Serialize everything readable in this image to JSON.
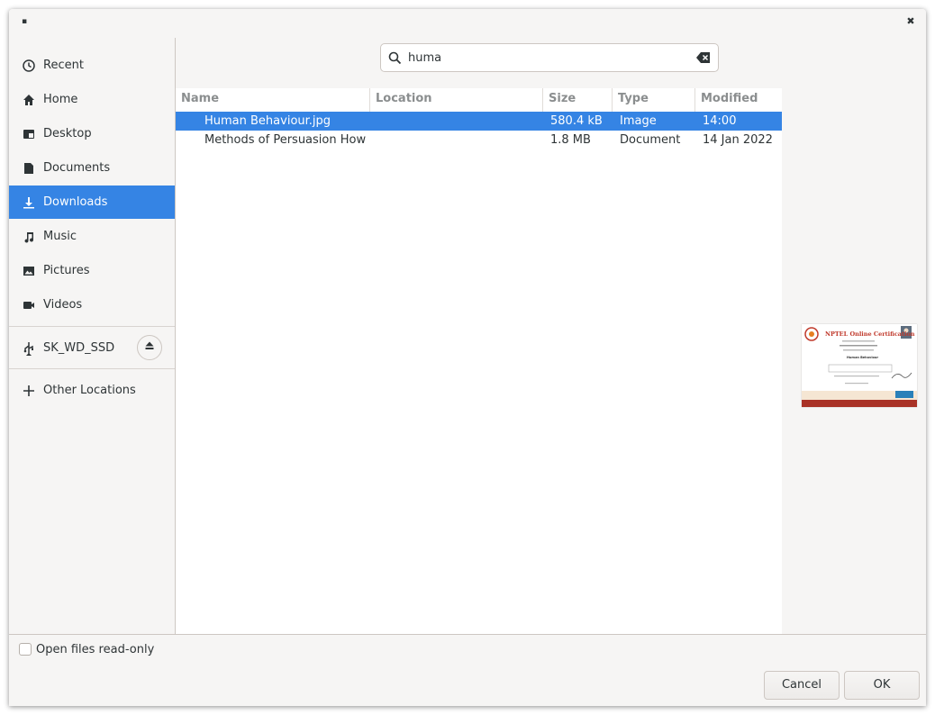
{
  "titlebar": {
    "menu_glyph": "▪",
    "close_glyph": "✖"
  },
  "sidebar": {
    "items": [
      {
        "label": "Recent",
        "icon": "clock-icon"
      },
      {
        "label": "Home",
        "icon": "home-icon"
      },
      {
        "label": "Desktop",
        "icon": "desktop-icon"
      },
      {
        "label": "Documents",
        "icon": "document-icon"
      },
      {
        "label": "Downloads",
        "icon": "download-icon",
        "selected": true
      },
      {
        "label": "Music",
        "icon": "music-note-icon"
      },
      {
        "label": "Pictures",
        "icon": "picture-icon"
      },
      {
        "label": "Videos",
        "icon": "video-camera-icon"
      }
    ],
    "device": {
      "label": "SK_WD_SSD",
      "icon": "usb-icon",
      "eject_icon": "eject-icon"
    },
    "other_locations": {
      "label": "Other Locations",
      "icon": "plus-icon"
    }
  },
  "search": {
    "value": "huma"
  },
  "filelist": {
    "columns": [
      "Name",
      "Location",
      "Size",
      "Type",
      "Modified"
    ],
    "rows": [
      {
        "name": "Human Behaviour.jpg",
        "location": "",
        "size": "580.4 kB",
        "type": "Image",
        "modified": "14:00",
        "selected": true
      },
      {
        "name": "Methods of Persuasion How ...",
        "location": "",
        "size": "1.8 MB",
        "type": "Document",
        "modified": "14 Jan 2022",
        "selected": false
      }
    ]
  },
  "preview": {
    "thumb_title": "NPTEL Online Certification",
    "thumb_subject": "Human Behaviour"
  },
  "bottombar": {
    "read_only_label": "Open files read-only",
    "read_only_checked": false,
    "cancel_label": "Cancel",
    "ok_label": "OK"
  },
  "colors": {
    "accent": "#3584e4",
    "background": "#f6f5f4"
  }
}
